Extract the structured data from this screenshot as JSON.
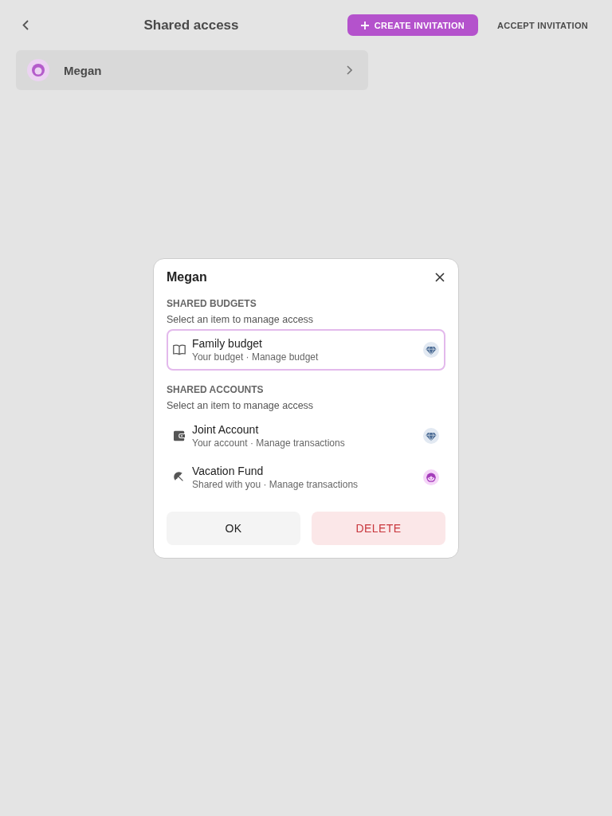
{
  "background": {
    "title": "Shared access",
    "actions": [
      {
        "label": "CREATE INVITATION",
        "primary": true
      },
      {
        "label": "ACCEPT INVITATION",
        "primary": false
      }
    ],
    "members": [
      {
        "name": "Megan"
      }
    ]
  },
  "dialog": {
    "title": "Megan",
    "sections": [
      {
        "heading": "SHARED BUDGETS",
        "hint": "Select an item to manage access",
        "items": [
          {
            "title": "Family budget",
            "subtitle": "Your budget · Manage budget",
            "selected": true,
            "owner": true
          }
        ]
      },
      {
        "heading": "SHARED ACCOUNTS",
        "hint": "Select an item to manage access",
        "items": [
          {
            "title": "Joint Account",
            "subtitle": "Your account · Manage transactions",
            "selected": false,
            "owner": true
          },
          {
            "title": "Vacation Fund",
            "subtitle": "Shared with you · Manage transactions",
            "selected": false,
            "owner": false
          }
        ]
      }
    ],
    "buttons": [
      {
        "label": "OK",
        "kind": "confirm"
      },
      {
        "label": "DELETE",
        "kind": "danger"
      }
    ]
  }
}
